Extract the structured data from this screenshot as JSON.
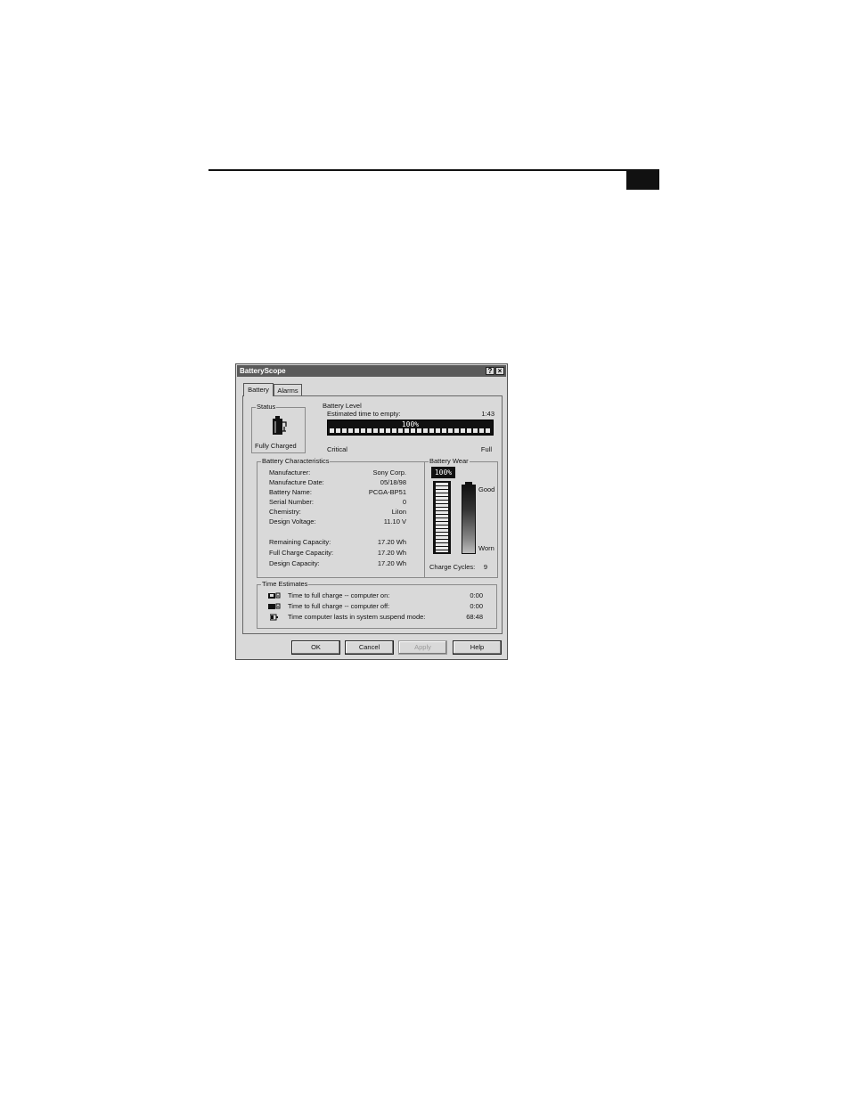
{
  "page": {
    "header_rule": true
  },
  "dialog": {
    "title": "BatteryScope",
    "help_button": "?",
    "close_button": "×",
    "tabs": [
      {
        "label": "Battery",
        "active": true
      },
      {
        "label": "Alarms",
        "active": false
      }
    ],
    "status": {
      "title": "Status",
      "text": "Fully Charged",
      "icon": "battery-plug-icon"
    },
    "battery_level": {
      "title": "Battery Level",
      "estimate_label": "Estimated time to empty:",
      "estimate_value": "1:43",
      "percent_text": "100%",
      "percent": 100,
      "min_label": "Critical",
      "max_label": "Full"
    },
    "characteristics": {
      "title": "Battery Characteristics",
      "rows": [
        {
          "label": "Manufacturer:",
          "value": "Sony Corp."
        },
        {
          "label": "Manufacture Date:",
          "value": "05/18/98"
        },
        {
          "label": "Battery Name:",
          "value": "PCGA-BP51"
        },
        {
          "label": "Serial Number:",
          "value": "0"
        },
        {
          "label": "Chemistry:",
          "value": "LiIon"
        },
        {
          "label": "Design Voltage:",
          "value": "11.10 V"
        }
      ],
      "capacity_rows": [
        {
          "label": "Remaining Capacity:",
          "value": "17.20 Wh"
        },
        {
          "label": "Full Charge Capacity:",
          "value": "17.20 Wh"
        },
        {
          "label": "Design Capacity:",
          "value": "17.20 Wh"
        }
      ]
    },
    "wear": {
      "title": "Battery Wear",
      "percent_text": "100%",
      "percent": 100,
      "good_label": "Good",
      "worn_label": "Worn",
      "cycles_label": "Charge Cycles:",
      "cycles_value": "9"
    },
    "time_estimates": {
      "title": "Time Estimates",
      "rows": [
        {
          "icon": "computer-on-charge-icon",
          "label": "Time to full charge -- computer on:",
          "value": "0:00"
        },
        {
          "icon": "computer-off-charge-icon",
          "label": "Time to full charge -- computer off:",
          "value": "0:00"
        },
        {
          "icon": "suspend-battery-icon",
          "label": "Time computer lasts in system suspend mode:",
          "value": "68:48"
        }
      ]
    },
    "buttons": {
      "ok": "OK",
      "cancel": "Cancel",
      "apply": "Apply",
      "help": "Help"
    }
  }
}
